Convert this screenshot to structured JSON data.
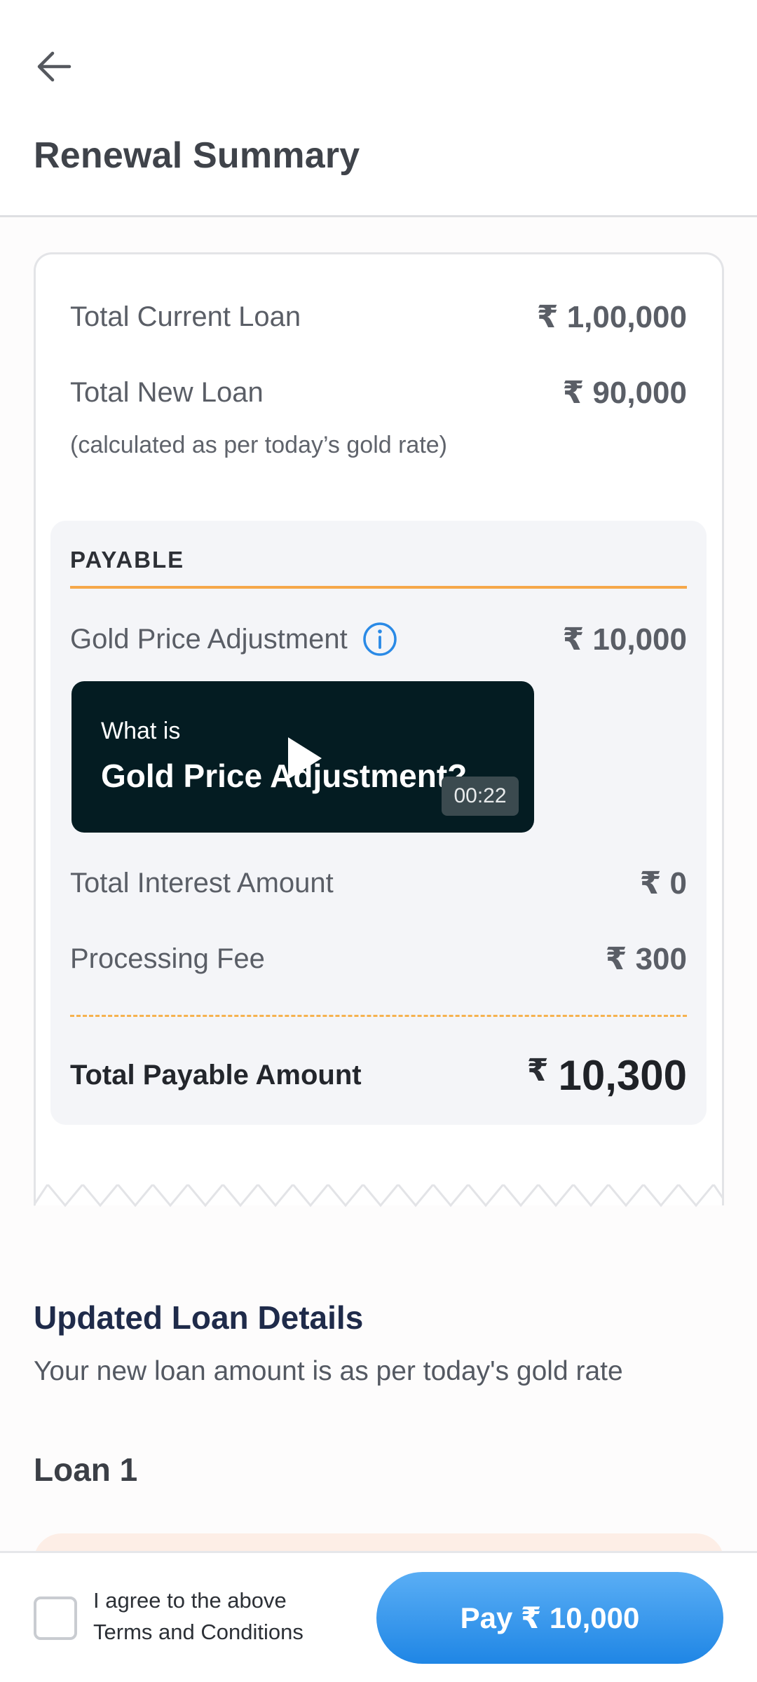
{
  "header": {
    "title": "Renewal Summary"
  },
  "summary": {
    "current_loan": {
      "label": "Total Current Loan",
      "value": "₹ 1,00,000"
    },
    "new_loan": {
      "label": "Total New Loan",
      "value": "₹ 90,000",
      "note": "(calculated as per today’s gold rate)"
    },
    "payable": {
      "title": "PAYABLE",
      "gold_adjustment": {
        "label": "Gold Price Adjustment",
        "value": "₹ 10,000"
      },
      "video": {
        "line1": "What is",
        "line2": "Gold Price Adjustment?",
        "duration": "00:22"
      },
      "interest": {
        "label": "Total Interest Amount",
        "value": "₹ 0"
      },
      "processing_fee": {
        "label": "Processing Fee",
        "value": "₹ 300"
      },
      "total": {
        "label": "Total Payable Amount",
        "currency": "₹",
        "value": "10,300"
      }
    }
  },
  "updated_details": {
    "title": "Updated Loan Details",
    "subtitle": "Your new loan amount is as per today's gold rate",
    "loan_title": "Loan 1"
  },
  "footer": {
    "agree_line1": "I agree to the above",
    "agree_line2": "Terms and Conditions",
    "checked": false,
    "pay_label": "Pay ₹ 10,000"
  },
  "colors": {
    "accent_blue": "#1f86e5",
    "divider_orange": "#f6a84a",
    "video_bg": "#041c22"
  }
}
